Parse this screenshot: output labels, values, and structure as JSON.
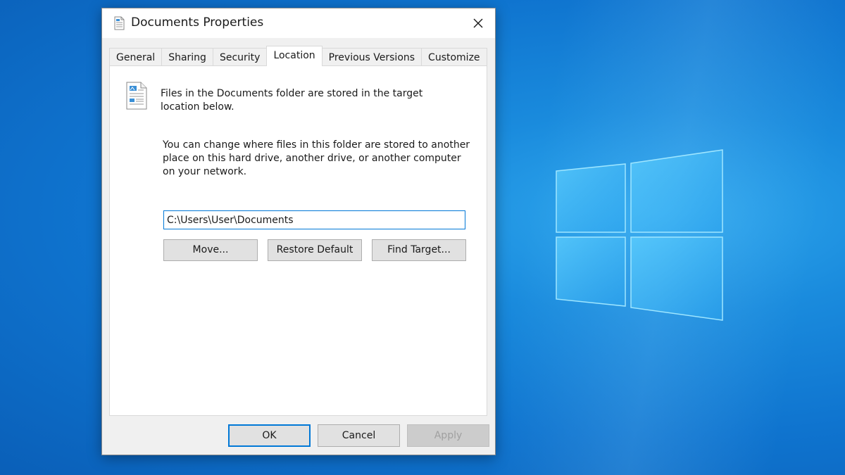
{
  "window": {
    "title": "Documents Properties",
    "icon": "document-folder-icon"
  },
  "tabs": [
    {
      "label": "General",
      "active": false
    },
    {
      "label": "Sharing",
      "active": false
    },
    {
      "label": "Security",
      "active": false
    },
    {
      "label": "Location",
      "active": true
    },
    {
      "label": "Previous Versions",
      "active": false
    },
    {
      "label": "Customize",
      "active": false
    }
  ],
  "location": {
    "intro": "Files in the Documents folder are stored in the target location below.",
    "description": "You can change where files in this folder are stored to another place on this hard drive, another drive, or another computer on your network.",
    "path": "C:\\Users\\User\\Documents",
    "move_label": "Move...",
    "restore_label": "Restore Default",
    "find_label": "Find Target..."
  },
  "footer": {
    "ok_label": "OK",
    "cancel_label": "Cancel",
    "apply_label": "Apply",
    "apply_enabled": false
  },
  "colors": {
    "accent": "#0078d7",
    "desktop_bg": "#0f74cf"
  }
}
